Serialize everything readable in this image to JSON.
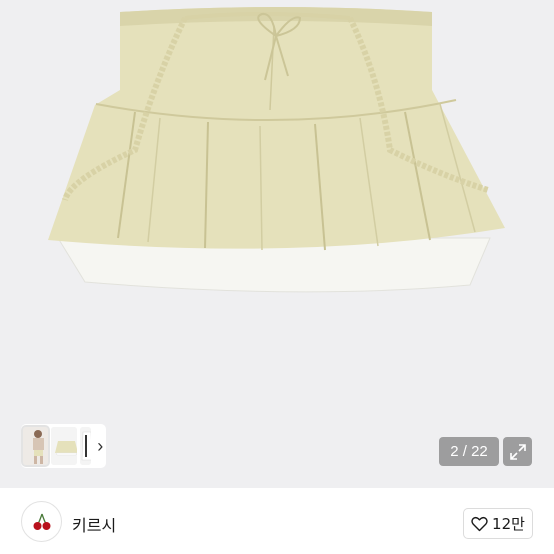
{
  "gallery": {
    "current_page": "2 / 22",
    "expand_icon": "expand-arrows-icon",
    "next_icon": "chevron-right-icon",
    "thumbnails": [
      "outfit-photo",
      "skirt-photo",
      "lace-skirt-photo"
    ],
    "background_color": "#efeff1",
    "product_color": "#e5e1bb"
  },
  "seller": {
    "name": "키르시",
    "avatar_icon": "cherry-logo-icon"
  },
  "like": {
    "icon": "heart-outline-icon",
    "count": "12만"
  }
}
